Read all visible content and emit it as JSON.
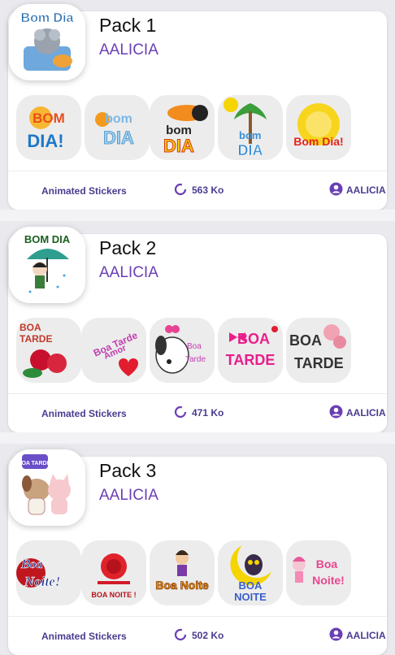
{
  "packs": [
    {
      "title": "Pack 1",
      "author": "AALICIA",
      "icon_name": "bom-dia-mouse-sticker-icon",
      "icon_text": "Bom Dia",
      "stickers": [
        {
          "name": "bom-dia-sun-sticker",
          "text": "BOM DIA!"
        },
        {
          "name": "bom-dia-bubble-sticker",
          "text": "bom DIA"
        },
        {
          "name": "bom-dia-toucan-sticker",
          "text": "bom DIA"
        },
        {
          "name": "bom-dia-palm-sticker",
          "text": "bom DIA"
        },
        {
          "name": "bom-dia-yellow-sun-sticker",
          "text": "Bom Dia!"
        }
      ],
      "type_label": "Animated Stickers",
      "size": "563 Ko",
      "owner": "AALICIA"
    },
    {
      "title": "Pack 2",
      "author": "AALICIA",
      "icon_name": "bom-dia-umbrella-girl-icon",
      "icon_text": "BOM DIA",
      "stickers": [
        {
          "name": "boa-tarde-roses-sticker",
          "text": "BOA TARDE"
        },
        {
          "name": "boa-tarde-amor-sticker",
          "text": "Boa Tarde Amor"
        },
        {
          "name": "boa-tarde-puppy-sticker",
          "text": "Boa Tarde"
        },
        {
          "name": "boa-tarde-pink-sticker",
          "text": "BOA TARDE"
        },
        {
          "name": "boa-tarde-flowers-sticker",
          "text": "BOA TARDE"
        }
      ],
      "type_label": "Animated Stickers",
      "size": "471 Ko",
      "owner": "AALICIA"
    },
    {
      "title": "Pack 3",
      "author": "AALICIA",
      "icon_name": "boa-tarde-dog-cat-icon",
      "icon_text": "BOA TARDE!",
      "stickers": [
        {
          "name": "boa-noite-red-sticker",
          "text": "Boa Noite!"
        },
        {
          "name": "boa-noite-rose-sticker",
          "text": "BOA NOITE !"
        },
        {
          "name": "boa-noite-girl-sticker",
          "text": "Boa Noite"
        },
        {
          "name": "boa-noite-owl-sticker",
          "text": "BOA NOITE"
        },
        {
          "name": "boa-noite-pink-sticker",
          "text": "Boa Noite!"
        }
      ],
      "type_label": "Animated Stickers",
      "size": "502 Ko",
      "owner": "AALICIA"
    }
  ],
  "colors": {
    "accent": "#6a3fb5",
    "footer_text": "#4b3b8f",
    "card": "#ffffff",
    "background": "#e9e9ee"
  }
}
